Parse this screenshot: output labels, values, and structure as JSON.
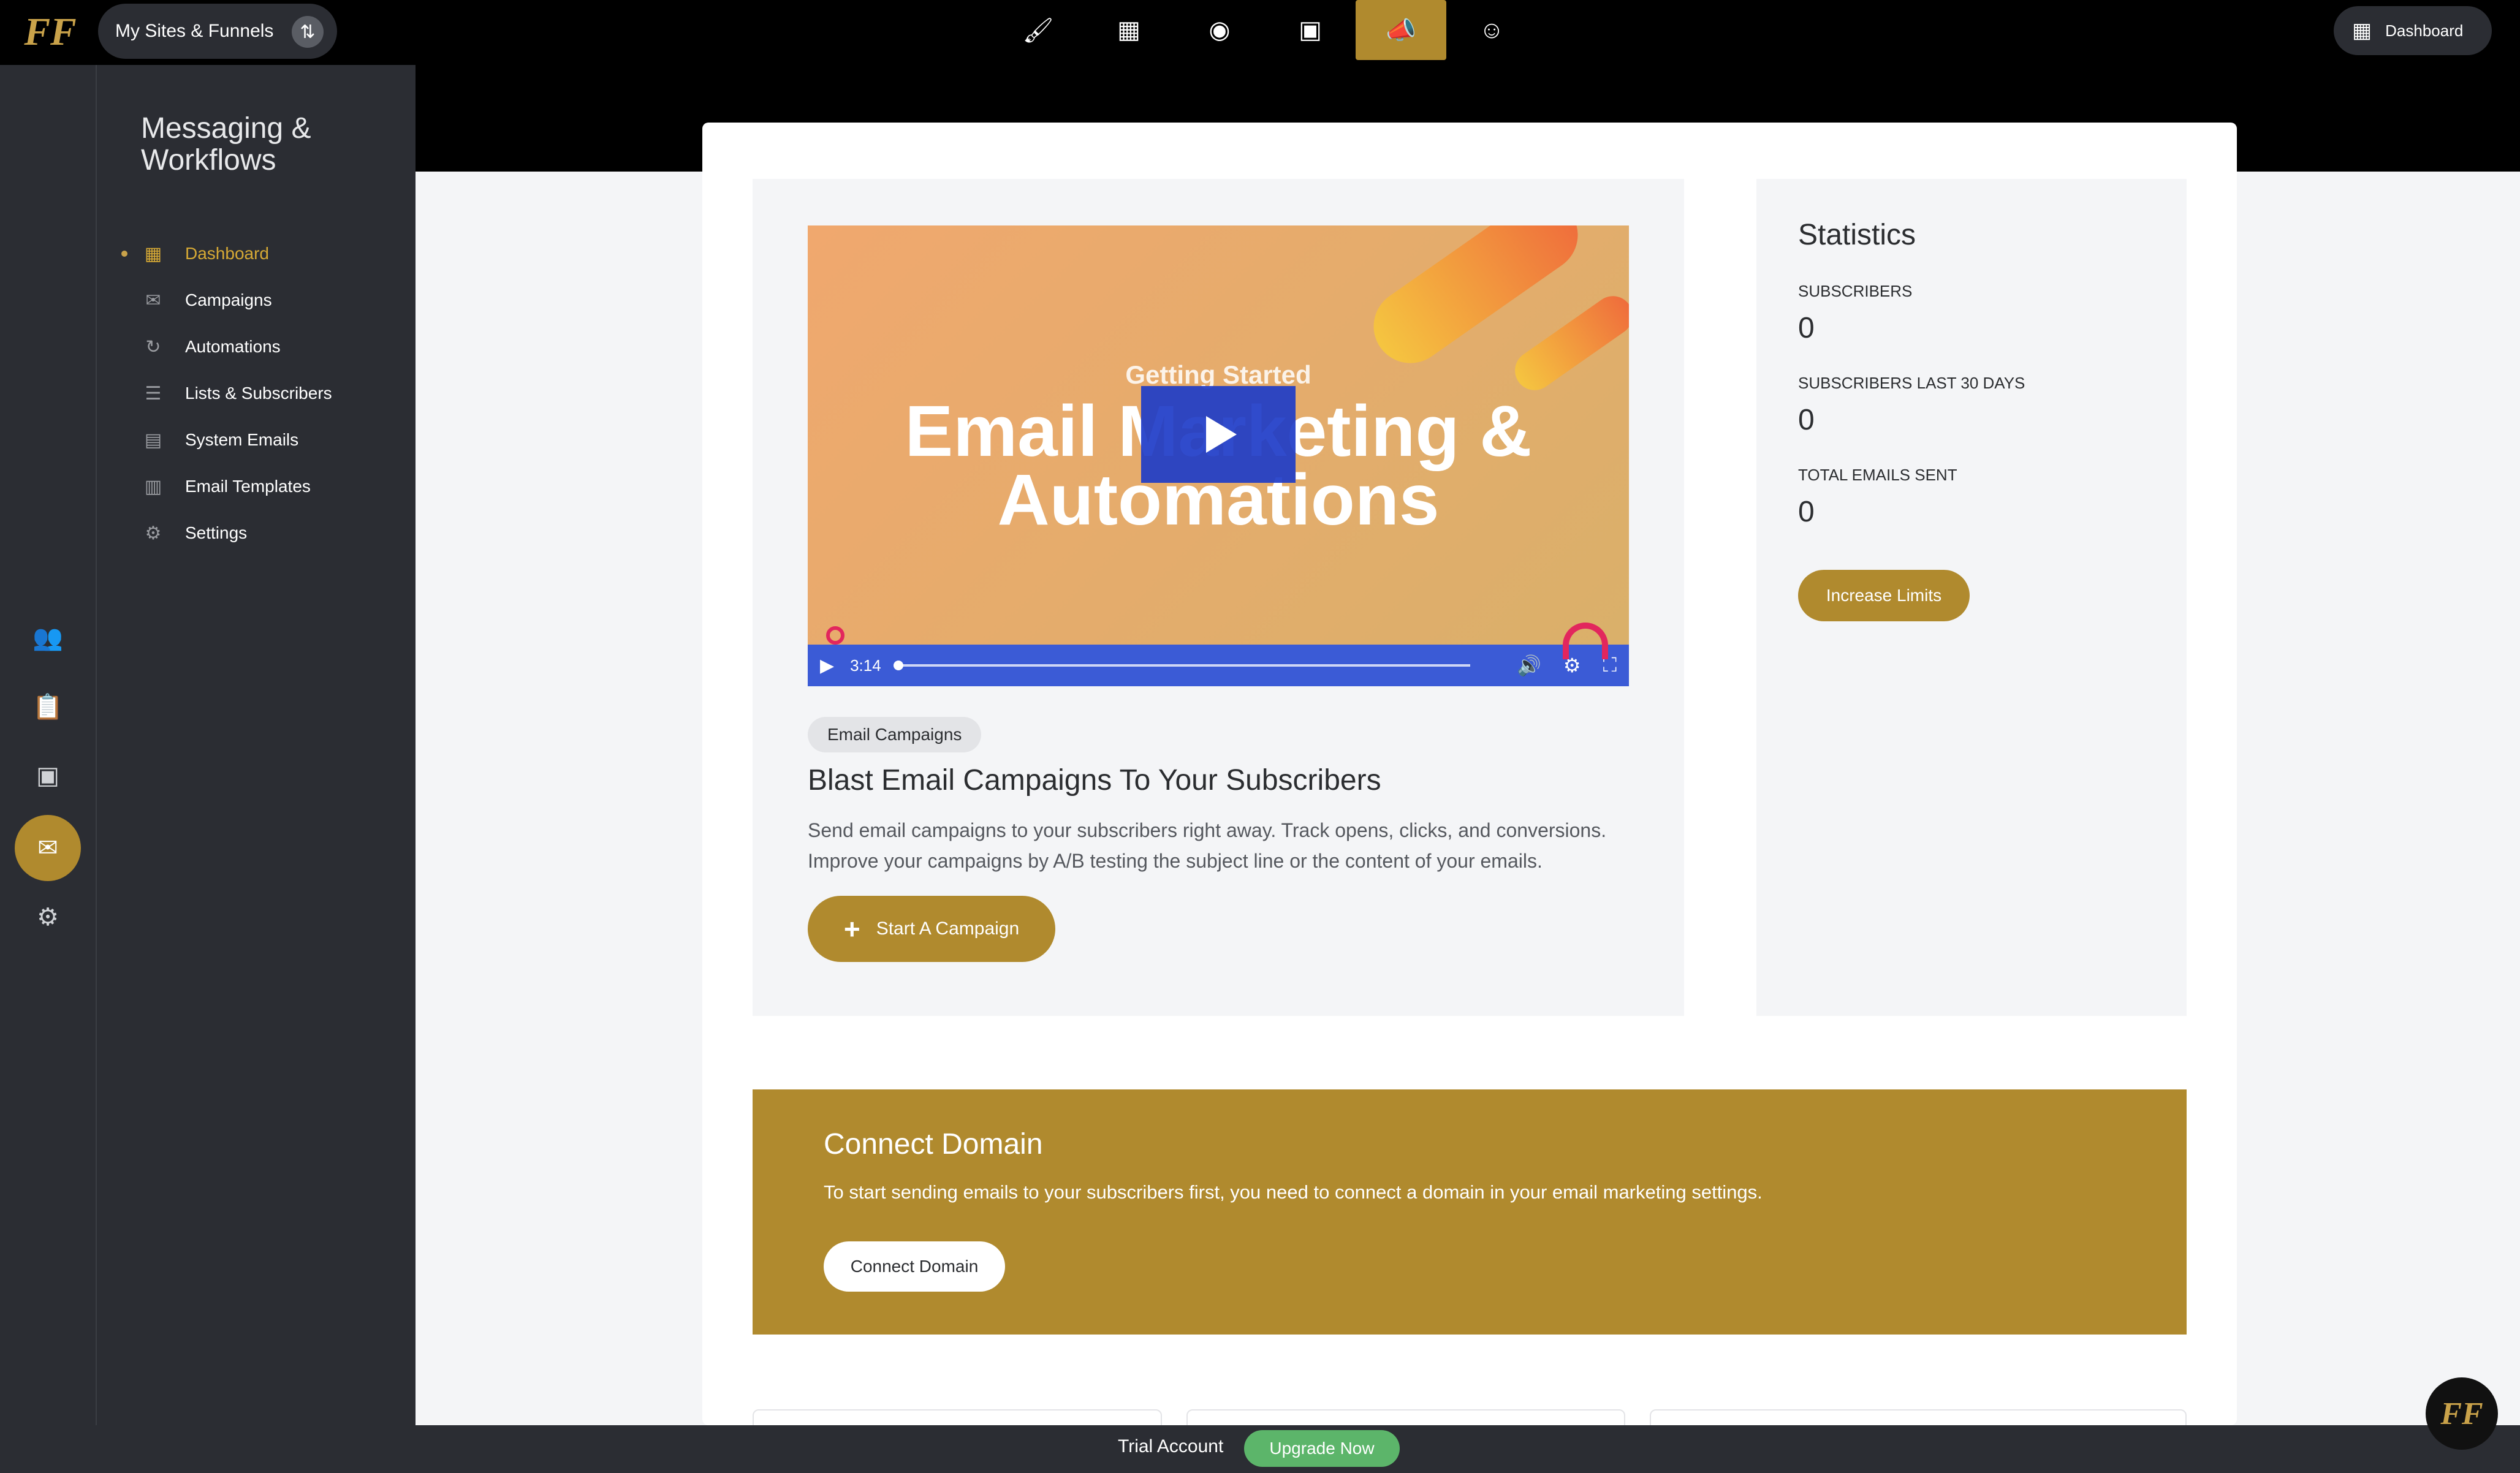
{
  "topbar": {
    "logo": "FF",
    "sites_label": "My Sites & Funnels",
    "dashboard_label": "Dashboard",
    "nav_icons": [
      "brush-icon",
      "store-icon",
      "palette-icon",
      "calendar-icon",
      "megaphone-icon",
      "smile-icon"
    ]
  },
  "rail": {
    "icons": [
      "contacts-icon",
      "clipboard-icon",
      "calendar-icon",
      "mail-icon",
      "gear-icon"
    ]
  },
  "sidebar": {
    "title": "Messaging & Workflows",
    "items": [
      {
        "label": "Dashboard",
        "icon": "grid-icon",
        "active": true
      },
      {
        "label": "Campaigns",
        "icon": "envelope-icon"
      },
      {
        "label": "Automations",
        "icon": "refresh-icon"
      },
      {
        "label": "Lists & Subscribers",
        "icon": "list-icon"
      },
      {
        "label": "System Emails",
        "icon": "table-icon"
      },
      {
        "label": "Email Templates",
        "icon": "template-icon"
      },
      {
        "label": "Settings",
        "icon": "gear-icon"
      }
    ]
  },
  "video": {
    "subtitle": "Getting Started",
    "title": "Email Marketing & Automations",
    "duration": "3:14"
  },
  "campaign": {
    "tag": "Email Campaigns",
    "heading": "Blast Email Campaigns To Your Subscribers",
    "description": "Send email campaigns to your subscribers right away. Track opens, clicks, and conversions. Improve your campaigns by A/B testing the subject line or the content of your emails.",
    "button": "Start A Campaign"
  },
  "stats": {
    "title": "Statistics",
    "items": [
      {
        "label": "SUBSCRIBERS",
        "value": "0"
      },
      {
        "label": "SUBSCRIBERS LAST 30 DAYS",
        "value": "0"
      },
      {
        "label": "TOTAL EMAILS SENT",
        "value": "0"
      }
    ],
    "button": "Increase Limits"
  },
  "domain": {
    "title": "Connect Domain",
    "text": "To start sending emails to your subscribers first, you need to connect a domain in your email marketing settings.",
    "button": "Connect Domain"
  },
  "footer": {
    "trial": "Trial Account",
    "upgrade": "Upgrade Now"
  },
  "chat": {
    "logo": "FF"
  },
  "colors": {
    "accent": "#b08a2e",
    "sidebar": "#2b2d33",
    "upgrade": "#5cb56a",
    "video_bar": "#3b5bd6"
  }
}
